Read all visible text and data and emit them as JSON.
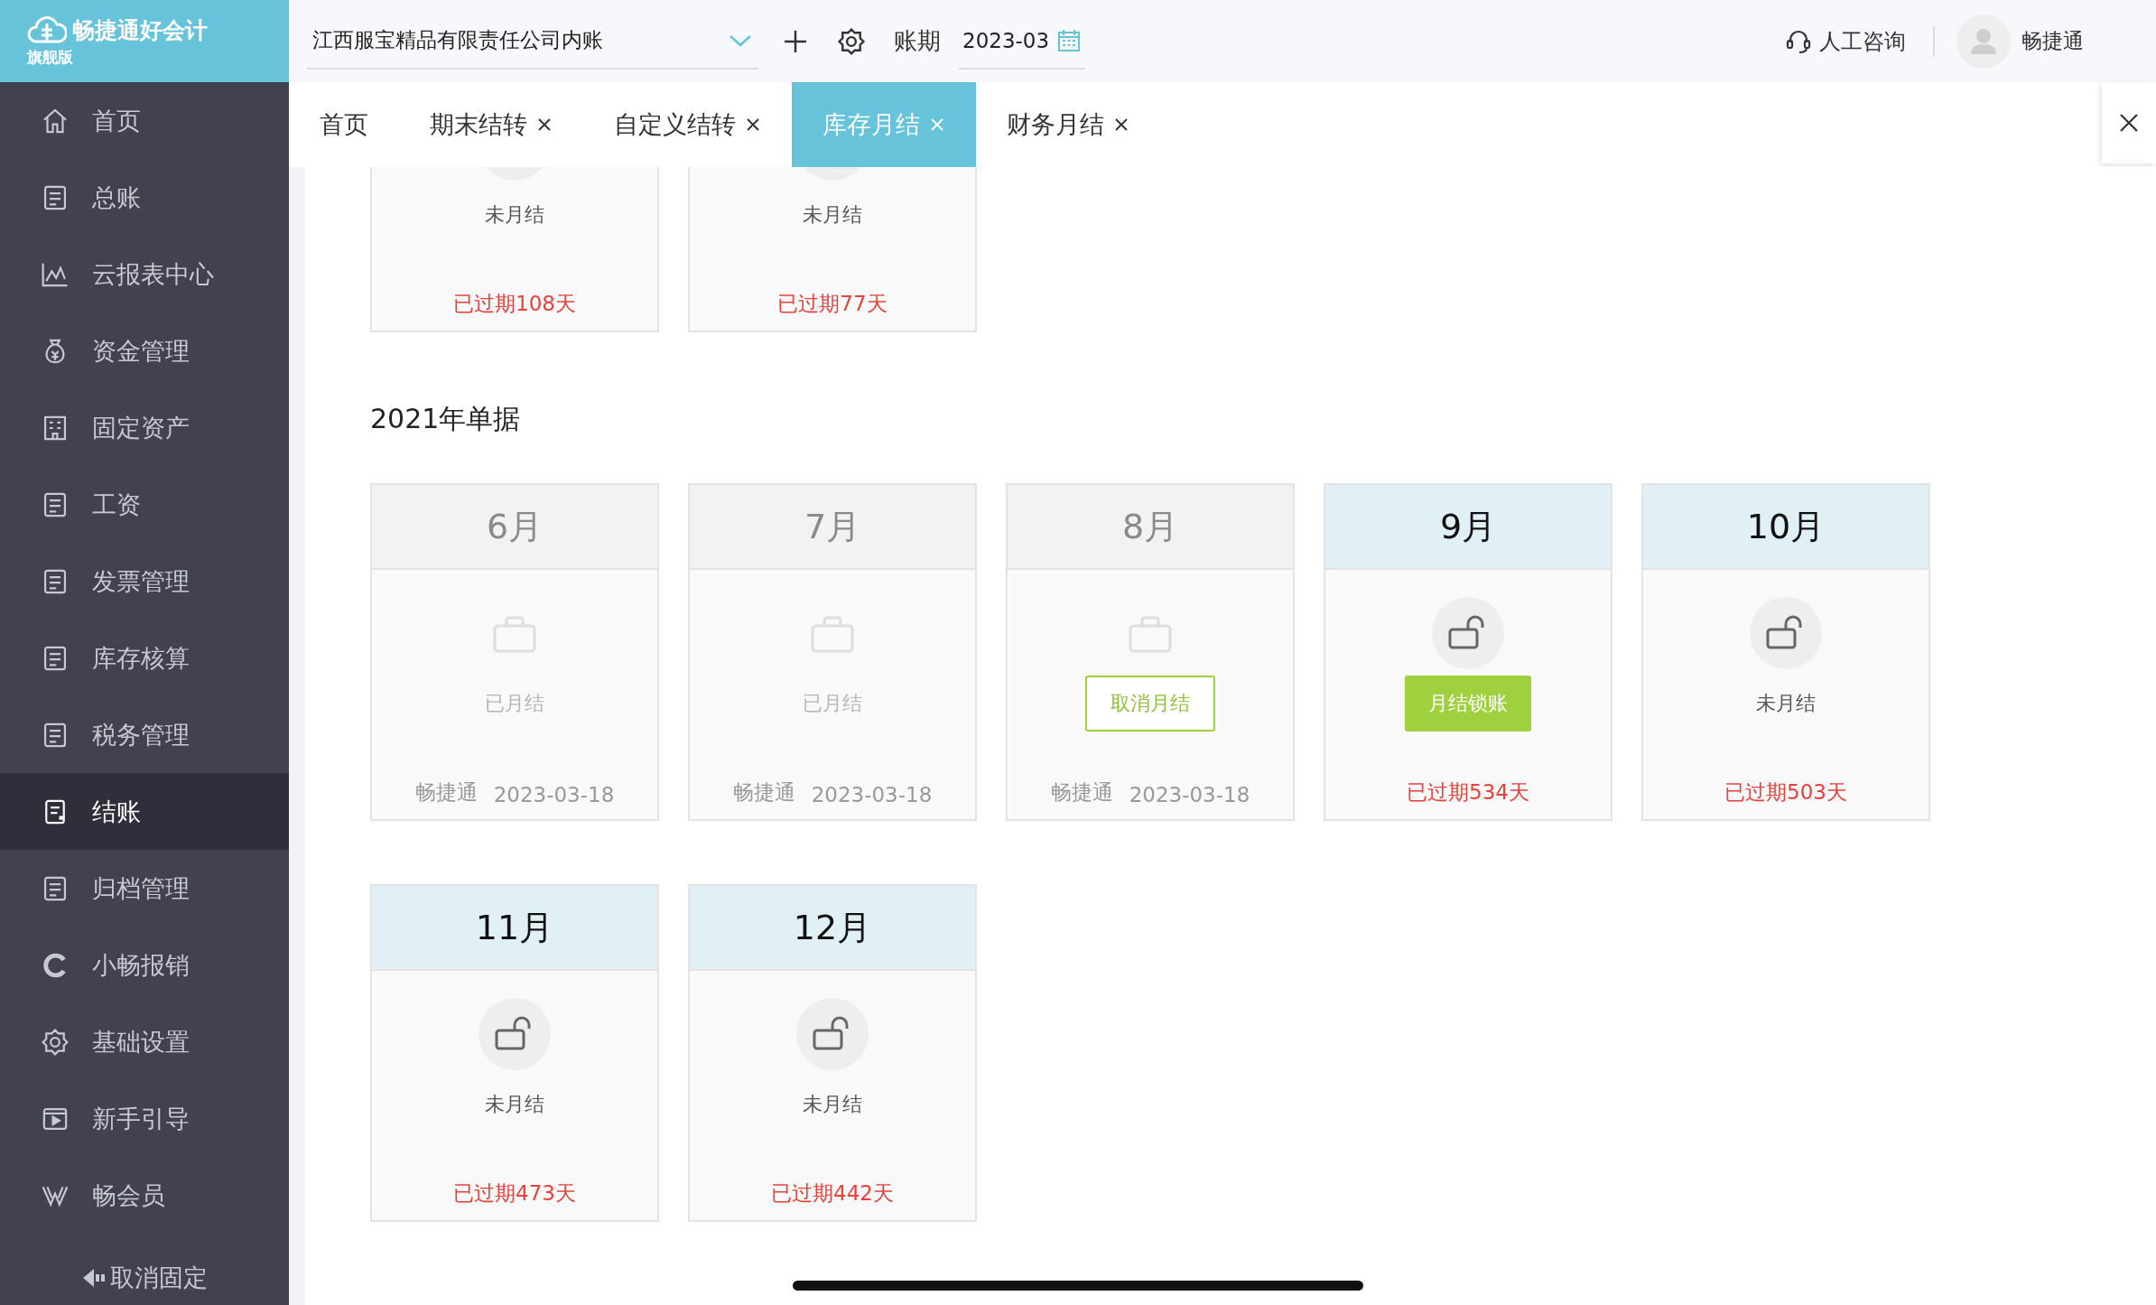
{
  "logo": {
    "title": "畅捷通好会计",
    "edition": "旗舰版"
  },
  "topbar": {
    "company": "江西服宝精品有限责任公司内账",
    "period_label": "账期",
    "period": "2023-03",
    "support": "人工咨询",
    "user": "畅捷通"
  },
  "sidebar": {
    "items": [
      {
        "label": "首页",
        "selected": false
      },
      {
        "label": "总账",
        "selected": false
      },
      {
        "label": "云报表中心",
        "selected": false
      },
      {
        "label": "资金管理",
        "selected": false
      },
      {
        "label": "固定资产",
        "selected": false
      },
      {
        "label": "工资",
        "selected": false
      },
      {
        "label": "发票管理",
        "selected": false
      },
      {
        "label": "库存核算",
        "selected": false
      },
      {
        "label": "税务管理",
        "selected": false
      },
      {
        "label": "结账",
        "selected": true
      },
      {
        "label": "归档管理",
        "selected": false
      },
      {
        "label": "小畅报销",
        "selected": false
      },
      {
        "label": "基础设置",
        "selected": false
      },
      {
        "label": "新手引导",
        "selected": false
      },
      {
        "label": "畅会员",
        "selected": false
      }
    ],
    "unpin": "取消固定"
  },
  "tabs": [
    {
      "label": "首页",
      "closable": false,
      "selected": false
    },
    {
      "label": "期末结转",
      "closable": true,
      "selected": false
    },
    {
      "label": "自定义结转",
      "closable": true,
      "selected": false
    },
    {
      "label": "库存月结",
      "closable": true,
      "selected": true
    },
    {
      "label": "财务月结",
      "closable": true,
      "selected": false
    }
  ],
  "sections": [
    {
      "cards": [
        {
          "locked": false,
          "status": "未月结",
          "expired": "已过期108天"
        },
        {
          "locked": false,
          "status": "未月结",
          "expired": "已过期77天"
        }
      ]
    },
    {
      "title": "2021年单据",
      "cards": [
        {
          "month": "6月",
          "locked": true,
          "status": "已月结",
          "user": "畅捷通",
          "date": "2023-03-18"
        },
        {
          "month": "7月",
          "locked": true,
          "status": "已月结",
          "user": "畅捷通",
          "date": "2023-03-18"
        },
        {
          "month": "8月",
          "locked": true,
          "button": {
            "label": "取消月结",
            "kind": "outline"
          },
          "user": "畅捷通",
          "date": "2023-03-18"
        },
        {
          "month": "9月",
          "locked": false,
          "button": {
            "label": "月结锁账",
            "kind": "solid"
          },
          "expired": "已过期534天"
        },
        {
          "month": "10月",
          "locked": false,
          "status": "未月结",
          "expired": "已过期503天"
        },
        {
          "month": "11月",
          "locked": false,
          "status": "未月结",
          "expired": "已过期473天"
        },
        {
          "month": "12月",
          "locked": false,
          "status": "未月结",
          "expired": "已过期442天"
        }
      ]
    }
  ]
}
